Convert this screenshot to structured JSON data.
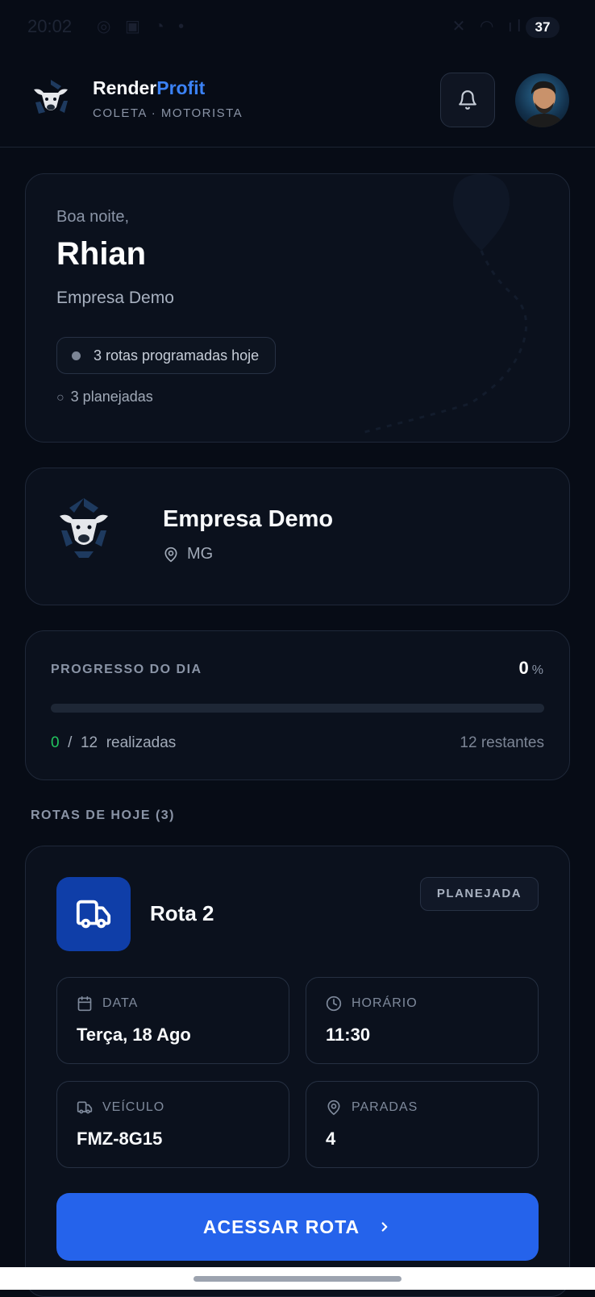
{
  "status_bar": {
    "time": "20:02",
    "battery": "37"
  },
  "header": {
    "brand_first": "Render",
    "brand_accent": "Profit",
    "subtitle": "COLETA · MOTORISTA"
  },
  "greeting": {
    "salutation": "Boa noite,",
    "name": "Rhian",
    "company": "Empresa Demo",
    "routes_today": "3 rotas programadas hoje",
    "planned": "3 planejadas"
  },
  "company_card": {
    "name": "Empresa Demo",
    "state": "MG"
  },
  "progress": {
    "title": "PROGRESSO DO DIA",
    "percent": "0",
    "percent_sign": "%",
    "fraction": 0,
    "done_count": "0",
    "separator": "/",
    "total": "12",
    "done_label": "realizadas",
    "remaining": "12 restantes"
  },
  "routes_section": {
    "title": "ROTAS DE HOJE (3)"
  },
  "route": {
    "name": "Rota 2",
    "status": "PLANEJADA",
    "date_label": "DATA",
    "date_value": "Terça, 18 Ago",
    "time_label": "HORÁRIO",
    "time_value": "11:30",
    "vehicle_label": "VEÍCULO",
    "vehicle_value": "FMZ-8G15",
    "stops_label": "PARADAS",
    "stops_value": "4",
    "cta_label": "ACESSAR ROTA"
  },
  "colors": {
    "accent": "#3b82f6",
    "success": "#22c55e",
    "cta": "#2563eb",
    "background": "#070c16"
  }
}
